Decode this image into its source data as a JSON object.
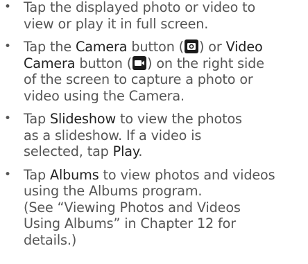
{
  "bullet_glyph": "•",
  "items": [
    {
      "lines": [
        {
          "text": "Tap the displayed photo or video to"
        },
        {
          "text": "view or play it in full screen."
        }
      ]
    },
    {
      "line1_a": "Tap the ",
      "line1_camera": "Camera",
      "line1_b": " button (",
      "line1_c": ") or ",
      "line1_video": "Video",
      "line2_camera": "Camera",
      "line2_a": " button (",
      "line2_b": ") on the right side",
      "line3": "of the screen to capture a photo or",
      "line4": "video using the Camera.",
      "camera_icon": "camera-icon",
      "video_camera_icon": "video-camera-icon"
    },
    {
      "line1_a": "Tap ",
      "line1_slideshow": "Slideshow",
      "line1_b": " to view the photos",
      "line2": "as a slideshow. If a video is",
      "line3_a": "selected, tap ",
      "line3_play": "Play",
      "line3_b": "."
    },
    {
      "line1_a": "Tap ",
      "line1_albums": "Albums",
      "line1_b": " to view photos and videos",
      "line2": "using the Albums program.",
      "line3": "(See “Viewing Photos and Videos",
      "line4": "Using Albums” in Chapter 12 for",
      "line5": "details.)"
    }
  ]
}
